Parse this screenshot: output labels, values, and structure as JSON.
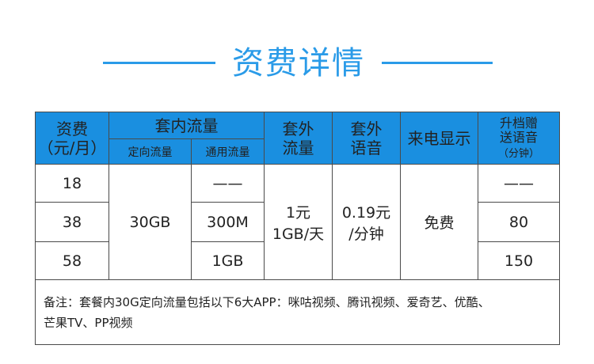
{
  "page": {
    "title": "资费详情",
    "accent_color": "#2a9be8",
    "header_bg": "#1a8fe0"
  },
  "table": {
    "headers": {
      "fee_line1": "资费",
      "fee_line2": "（元/月）",
      "in_package": "套内流量",
      "directed": "定向流量",
      "general": "通用流量",
      "outside_data_1": "套外",
      "outside_data_2": "流量",
      "outside_voice_1": "套外",
      "outside_voice_2": "语音",
      "caller_id": "来电显示",
      "bonus_1": "升档赠",
      "bonus_2": "送语音",
      "bonus_3": "（分钟）"
    },
    "rows": [
      {
        "fee": "18",
        "general": "——",
        "bonus": "——"
      },
      {
        "fee": "38",
        "general": "300M",
        "bonus": "80"
      },
      {
        "fee": "58",
        "general": "1GB",
        "bonus": "150"
      }
    ],
    "shared": {
      "directed": "30GB",
      "outside_data_1": "1元",
      "outside_data_2": "1GB/天",
      "outside_voice_1": "0.19元",
      "outside_voice_2": "/分钟",
      "caller_id": "免费"
    },
    "note_line1": "备注：套餐内30G定向流量包括以下6大APP：咪咕视频、腾讯视频、爱奇艺、优酷、",
    "note_line2": "芒果TV、PP视频"
  }
}
